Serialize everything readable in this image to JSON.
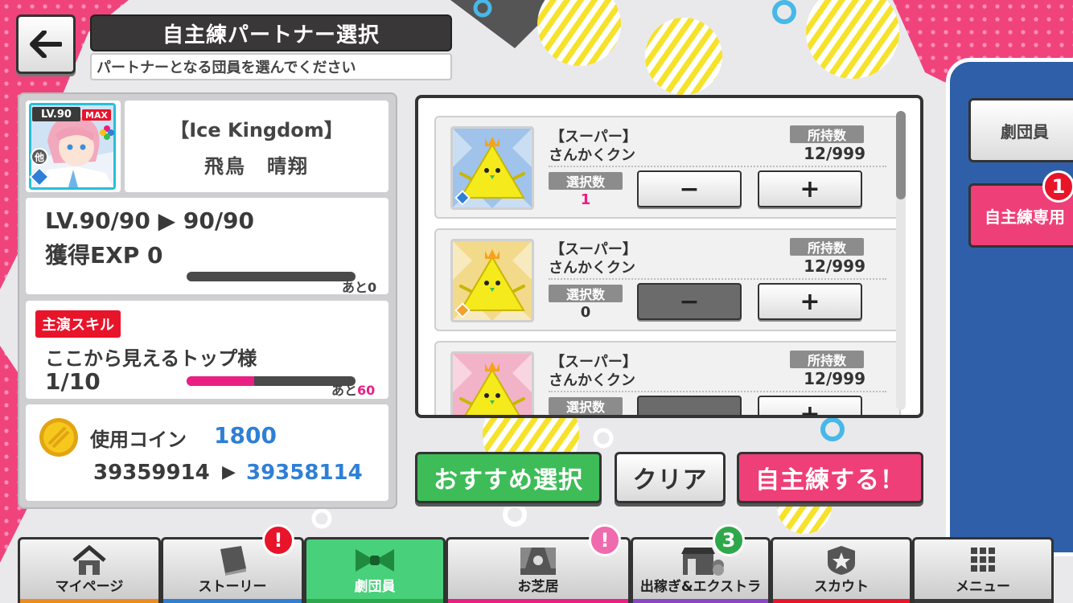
{
  "header": {
    "title": "自主練パートナー選択",
    "subtitle": "パートナーとなる団員を選んでください",
    "back_icon": "arrow-left-icon"
  },
  "member": {
    "level_badge": "LV.90",
    "max_badge": "MAX",
    "other_badge": "他",
    "title": "【Ice Kingdom】",
    "name": "飛鳥　晴翔",
    "level_text": "LV.90/90 ▶ 90/90",
    "exp_text": "獲得EXP 0",
    "exp_remaining_label": "あと0",
    "exp_progress": 1.0
  },
  "skill": {
    "tag": "主演スキル",
    "name": "ここから見えるトップ様",
    "level": "1/10",
    "remaining_prefix": "あと",
    "remaining_value": "60",
    "progress": 0.4
  },
  "coins": {
    "label": "使用コイン",
    "cost": "1800",
    "before": "39359914",
    "arrow": "▶",
    "after": "39358114"
  },
  "partners": [
    {
      "name_line1": "【スーパー】",
      "name_line2": "さんかくクン",
      "owned_label": "所持数",
      "owned_value": "12/999",
      "selected_label": "選択数",
      "selected_value": "1",
      "minus": "−",
      "plus": "+",
      "theme_color": "#9fc3ea",
      "attribute_color": "#2f7fd6"
    },
    {
      "name_line1": "【スーパー】",
      "name_line2": "さんかくクン",
      "owned_label": "所持数",
      "owned_value": "12/999",
      "selected_label": "選択数",
      "selected_value": "0",
      "minus": "−",
      "plus": "+",
      "theme_color": "#f3d98a",
      "attribute_color": "#f2a12d"
    },
    {
      "name_line1": "【スーパー】",
      "name_line2": "さんかくクン",
      "owned_label": "所持数",
      "owned_value": "12/999",
      "selected_label": "選択数",
      "selected_value": "",
      "minus": "",
      "plus": "+",
      "theme_color": "#f2b3c8",
      "attribute_color": "#ea1f84"
    }
  ],
  "actions": {
    "recommend": "おすすめ選択",
    "clear": "クリア",
    "train": "自主練する！"
  },
  "side_tabs": {
    "members": "劇団員",
    "training": "自主練専用",
    "training_badge": "1"
  },
  "nav": {
    "items": [
      {
        "label": "マイページ",
        "icon": "house-icon",
        "strip": "#f08a1c"
      },
      {
        "label": "ストーリー",
        "icon": "book-icon",
        "strip": "#2f7fd6",
        "badge": "!"
      },
      {
        "label": "劇団員",
        "icon": "ribbon-icon",
        "strip": "#2ea84a"
      },
      {
        "label": "お芝居",
        "icon": "stage-icon",
        "strip": "#ea1f84",
        "badge": "!"
      },
      {
        "label": "出稼ぎ&エクストラ",
        "icon": "shop-icon",
        "strip": "#8a46c9",
        "badge": "3"
      },
      {
        "label": "スカウト",
        "icon": "star-shield-icon",
        "strip": "#e8142a"
      },
      {
        "label": "メニュー",
        "icon": "grid-menu-icon",
        "strip": "#3a3a3a"
      }
    ]
  },
  "colors": {
    "accent_pink": "#ea1f84",
    "accent_blue": "#2f7fd6",
    "accent_green": "#3dbc58",
    "dark": "#3a3739"
  }
}
